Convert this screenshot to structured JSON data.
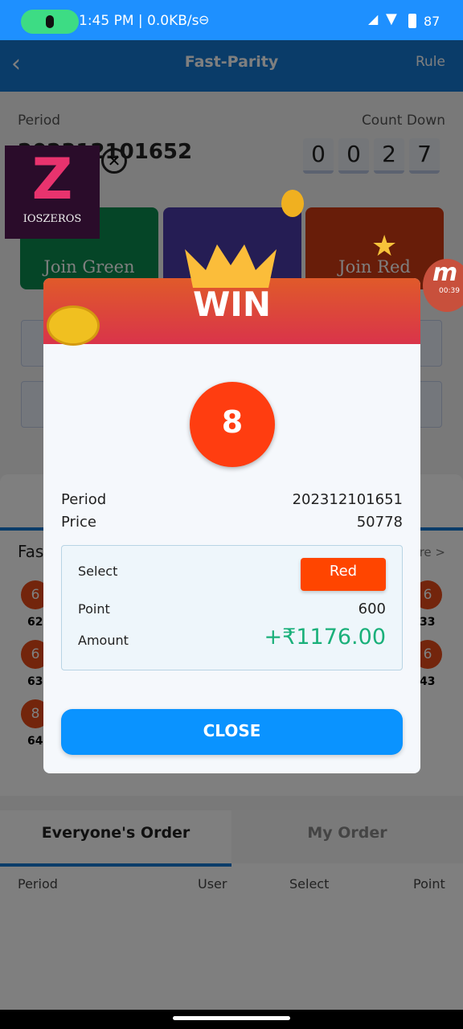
{
  "status_bar": {
    "time_speed": "1:45 PM | 0.0KB/s",
    "battery": "87",
    "icons": [
      "mic-icon",
      "dnd-icon",
      "signal-icon",
      "wifi-icon",
      "battery-icon"
    ]
  },
  "header": {
    "title": "Fast-Parity",
    "rule_label": "Rule",
    "back_icon": "chevron-left-icon"
  },
  "game": {
    "period_label": "Period",
    "period_value": "202312101652",
    "countdown_label": "Count Down",
    "countdown_digits": [
      "0",
      "0",
      "2",
      "7"
    ],
    "join_green": "Join Green",
    "join_red": "Join Red",
    "colors": {
      "green": "#0b8a4e",
      "violet": "#4b3aa8",
      "red": "#d03a12"
    }
  },
  "history": {
    "title": "Fast-Parity Record",
    "more": "More >",
    "left_balls": [
      {
        "num": "6",
        "period": "62"
      },
      {
        "num": "6",
        "period": "63"
      },
      {
        "num": "8",
        "period": "64"
      }
    ],
    "right_balls": [
      {
        "num": "6",
        "period": "33"
      },
      {
        "num": "6",
        "period": "43"
      }
    ]
  },
  "orders": {
    "tabs": [
      "Everyone's Order",
      "My Order"
    ],
    "columns": [
      "Period",
      "User",
      "Select",
      "Point"
    ]
  },
  "overlay_badge": {
    "logo_text": "IOSZEROS",
    "timer": "00:39"
  },
  "modal": {
    "title": "WIN",
    "number": "8",
    "period_label": "Period",
    "period_value": "202312101651",
    "price_label": "Price",
    "price_value": "50778",
    "select_label": "Select",
    "select_value": "Red",
    "point_label": "Point",
    "point_value": "600",
    "amount_label": "Amount",
    "amount_value": "+₹1176.00",
    "close_label": "CLOSE",
    "colors": {
      "accent": "#0a93ff",
      "win_amount": "#1ab07a",
      "red": "#ff4500"
    }
  }
}
